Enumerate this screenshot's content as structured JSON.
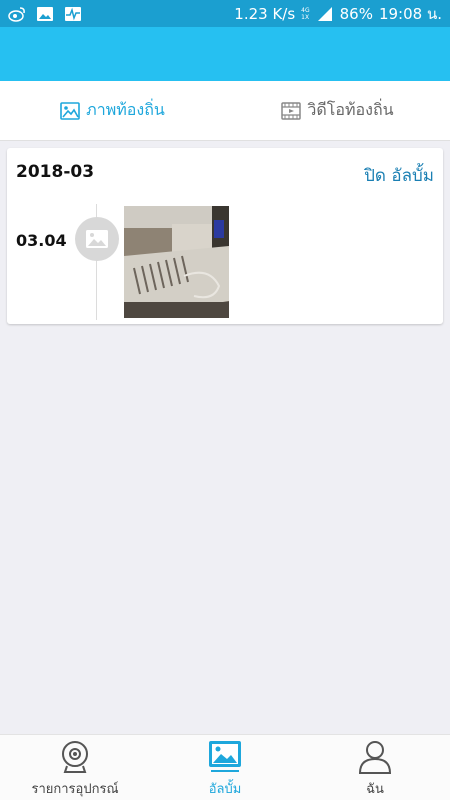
{
  "status_bar": {
    "speed": "1.23 K/s",
    "network_top": "4G",
    "network_bottom": "1X",
    "battery": "86%",
    "time": "19:08 น."
  },
  "tabs": [
    {
      "label": "ภาพท้องถิ่น",
      "icon": "image-icon",
      "active": true
    },
    {
      "label": "วิดีโอท้องถิ่น",
      "icon": "film-icon",
      "active": false
    }
  ],
  "album": {
    "month": "2018-03",
    "close_label": "ปิด อัลบั้ม",
    "day": "03.04"
  },
  "bottom_nav": [
    {
      "label": "รายการอุปกรณ์",
      "icon": "camera-icon",
      "active": false
    },
    {
      "label": "อัลบั้ม",
      "icon": "album-icon",
      "active": true
    },
    {
      "label": "ฉัน",
      "icon": "person-icon",
      "active": false
    }
  ],
  "colors": {
    "status_bar": "#1b9fd0",
    "app_bar": "#26c0f1",
    "accent": "#1ea7dc",
    "link": "#1a7fb3"
  }
}
